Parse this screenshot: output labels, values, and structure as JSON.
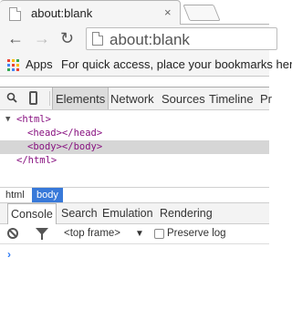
{
  "window": {
    "tab_title": "about:blank",
    "tab_close": "×",
    "url": "about:blank",
    "nav_back": "←",
    "nav_forward": "→",
    "nav_reload": "↻"
  },
  "bookmarks": {
    "apps_label": "Apps",
    "hint": "For quick access, place your bookmarks here",
    "apps_icon_colors": [
      "#e94235",
      "#fbbc04",
      "#34a853",
      "#4285f4",
      "#e94235",
      "#fbbc04",
      "#34a853",
      "#4285f4",
      "#e94235"
    ]
  },
  "devtools": {
    "tabs": [
      "Elements",
      "Network",
      "Sources",
      "Timeline",
      "Pr"
    ],
    "active_tab": "Elements",
    "dom": [
      {
        "open": "▼",
        "text": "<html>"
      },
      {
        "text": "<head></head>"
      },
      {
        "text": "<body></body>",
        "selected": true
      },
      {
        "text": "</html>"
      }
    ],
    "breadcrumbs": [
      "html",
      "body"
    ],
    "active_crumb": "body",
    "drawer_tabs": [
      "Console",
      "Search",
      "Emulation",
      "Rendering"
    ],
    "active_drawer_tab": "Console",
    "console": {
      "frame": "<top frame>",
      "frame_arrow": "▼",
      "preserve_log": "Preserve log",
      "prompt": "›"
    }
  }
}
